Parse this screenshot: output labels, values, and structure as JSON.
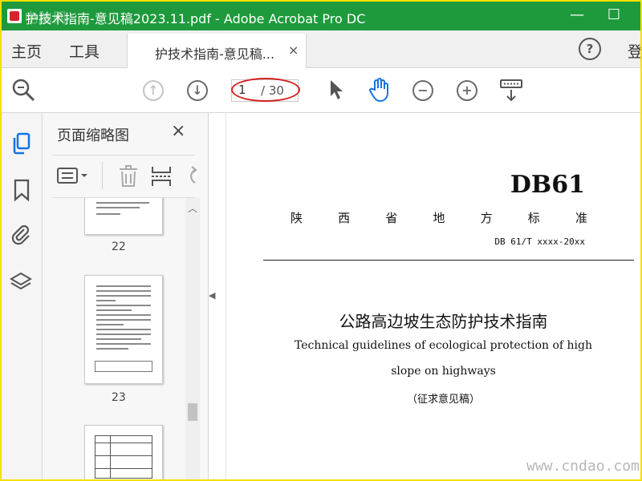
{
  "window": {
    "title": "护技术指南-意见稿2023.11.pdf - Adobe Acrobat Pro DC",
    "watermark": "电脑网",
    "minimize": "—",
    "maximize": "☐"
  },
  "menu": {
    "home": "主页",
    "tools": "工具",
    "help": "?",
    "login": "登"
  },
  "tab": {
    "label": "护技术指南-意见稿...",
    "close": "×"
  },
  "toolbar": {
    "page_current": "1",
    "page_total": "/ 30"
  },
  "panel": {
    "title": "页面缩略图",
    "close": "×",
    "thumbnails": [
      {
        "page": "22"
      },
      {
        "page": "23"
      }
    ]
  },
  "document": {
    "code": "DB61",
    "province_chars": [
      "陕",
      "西",
      "省",
      "地",
      "方",
      "标",
      "准"
    ],
    "standard_number": "DB 61/T xxxx-20xx",
    "title_cn": "公路高边坡生态防护技术指南",
    "title_en_line1": "Technical guidelines of ecological protection of high",
    "title_en_line2": "slope on highways",
    "draft_label": "（征求意见稿）"
  },
  "site_watermark": "www.cndao.com"
}
